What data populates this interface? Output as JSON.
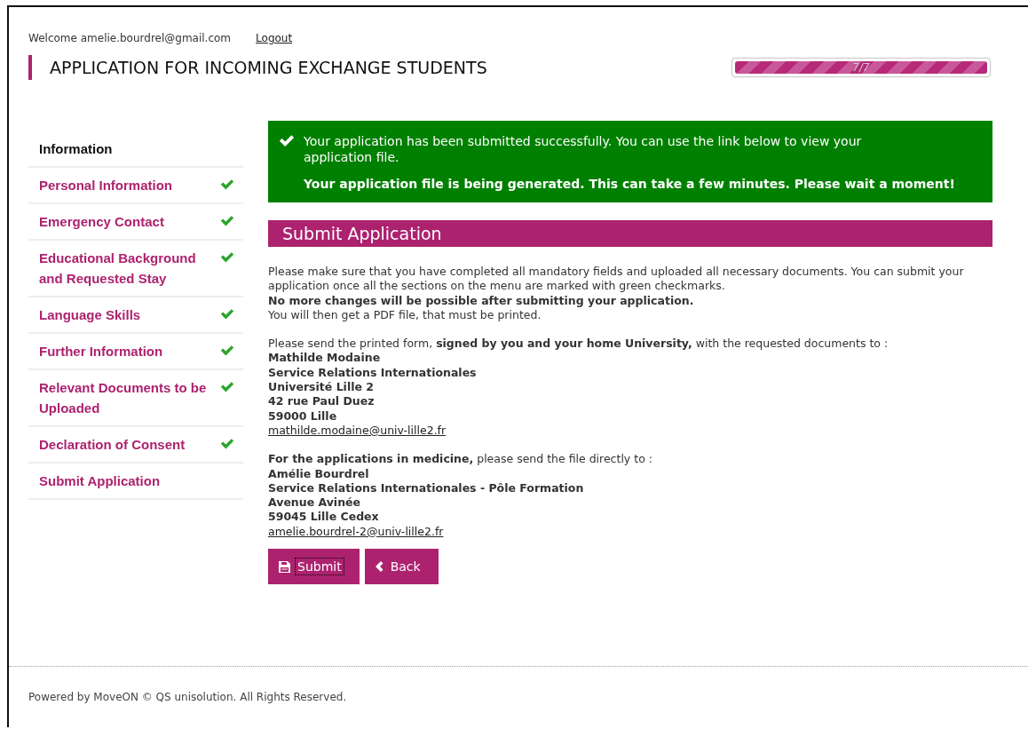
{
  "header": {
    "welcome": "Welcome amelie.bourdrel@gmail.com",
    "logout": "Logout",
    "title": "APPLICATION FOR INCOMING EXCHANGE STUDENTS",
    "progress": {
      "level": 1,
      "label": "7/7"
    }
  },
  "sidebar": {
    "items": [
      {
        "kind": "heading",
        "label": "Information",
        "complete": false
      },
      {
        "kind": "link",
        "label": "Personal Information",
        "complete": true
      },
      {
        "kind": "link",
        "label": "Emergency Contact",
        "complete": true
      },
      {
        "kind": "link",
        "label": "Educational Background and Requested Stay",
        "complete": true
      },
      {
        "kind": "link",
        "label": "Language Skills",
        "complete": true
      },
      {
        "kind": "link",
        "label": "Further Information",
        "complete": true
      },
      {
        "kind": "link",
        "label": "Relevant Documents to be Uploaded",
        "complete": true
      },
      {
        "kind": "link",
        "label": "Declaration of Consent",
        "complete": true
      },
      {
        "kind": "link",
        "label": "Submit Application",
        "complete": false
      }
    ]
  },
  "alert": {
    "message": "Your application has been submitted successfully. You can use the link below to view your application file.",
    "note": "Your application file is being generated. This can take a few minutes. Please wait a moment!"
  },
  "section": {
    "title": "Submit Application",
    "paragraphs": [
      [
        {
          "kind": "text",
          "text": "Please make sure that you have completed all mandatory fields and uploaded all necessary documents. You can submit your application once all the sections on the menu are marked with green checkmarks."
        },
        {
          "kind": "bold",
          "text": "No more changes will be possible after submitting your application."
        },
        {
          "kind": "text",
          "text": "You will then get a PDF file, that must be printed."
        }
      ],
      [
        {
          "kind": "text",
          "text": "Please send the printed form, **signed by you and your home University,** with the requested documents to :"
        },
        {
          "kind": "bold",
          "text": "Mathilde Modaine"
        },
        {
          "kind": "bold",
          "text": "Service Relations Internationales"
        },
        {
          "kind": "bold",
          "text": "Université Lille 2"
        },
        {
          "kind": "bold",
          "text": "42 rue Paul Duez"
        },
        {
          "kind": "bold",
          "text": "59000 Lille"
        },
        {
          "kind": "link",
          "text": "mathilde.modaine@univ-lille2.fr"
        }
      ],
      [
        {
          "kind": "text",
          "text": "**For the applications in medicine,** please send the file directly to :"
        },
        {
          "kind": "bold",
          "text": "Amélie Bourdrel"
        },
        {
          "kind": "bold",
          "text": "Service Relations Internationales - Pôle Formation"
        },
        {
          "kind": "bold",
          "text": "Avenue Avinée"
        },
        {
          "kind": "bold",
          "text": "59045 Lille Cedex"
        },
        {
          "kind": "link",
          "text": "amelie.bourdrel-2@univ-lille2.fr"
        }
      ]
    ],
    "buttons": [
      {
        "kind": "save",
        "label": "Submit",
        "focused": true
      },
      {
        "kind": "back",
        "label": "Back",
        "focused": false
      }
    ]
  },
  "footer": "Powered by MoveON © QS unisolution. All Rights Reserved."
}
